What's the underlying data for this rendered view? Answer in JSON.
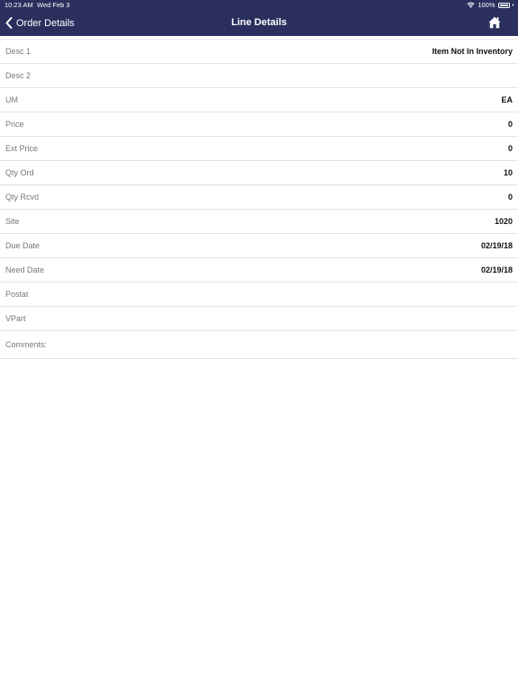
{
  "status_bar": {
    "time": "10:23 AM",
    "date": "Wed Feb 3",
    "battery": "100%"
  },
  "nav": {
    "back_label": "Order Details",
    "title": "Line Details",
    "home_icon": "home-icon",
    "back_icon": "chevron-left-icon"
  },
  "colors": {
    "nav_background": "#2b2f5e",
    "label": "#777777",
    "value": "#111111"
  },
  "rows": [
    {
      "label": "Desc 1",
      "value": "Item Not In Inventory"
    },
    {
      "label": "Desc 2",
      "value": ""
    },
    {
      "label": "UM",
      "value": "EA"
    },
    {
      "label": "Price",
      "value": "0"
    },
    {
      "label": "Ext Price",
      "value": "0"
    },
    {
      "label": "Qty Ord",
      "value": "10"
    },
    {
      "label": "Qty Rcvd",
      "value": "0"
    },
    {
      "label": "Site",
      "value": "1020"
    },
    {
      "label": "Due Date",
      "value": "02/19/18"
    },
    {
      "label": "Need Date",
      "value": "02/19/18"
    },
    {
      "label": "Postat",
      "value": ""
    },
    {
      "label": "VPart",
      "value": ""
    }
  ],
  "comments": {
    "label": "Comments:",
    "value": ""
  }
}
